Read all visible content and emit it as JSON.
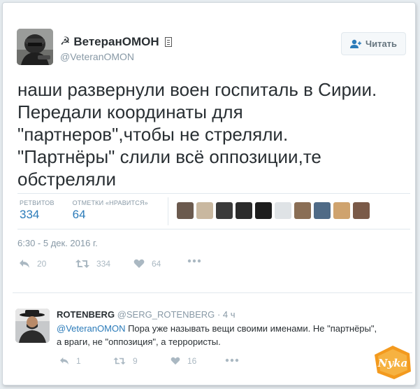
{
  "tweet": {
    "display_name": "ВетеранОМОН",
    "handle": "@VeteranOMON",
    "follow_label": "Читать",
    "text_lines": [
      "наши развернули воен госпиталь в Сирии.",
      "Передали координаты для",
      "\"партнеров\",чтобы не стреляли.",
      "\"Партнёры\" слили всё оппозиции,те",
      "обстреляли"
    ],
    "retweets_label": "РЕТВИТОВ",
    "retweets_value": "334",
    "likes_label": "ОТМЕТКИ «НРАВИТСЯ»",
    "likes_value": "64",
    "timestamp": "6:30 - 5 дек. 2016 г.",
    "reply_count": "20",
    "retweet_count": "334",
    "like_count": "64",
    "liker_colors": [
      "#6b5a4e",
      "#c9b8a0",
      "#3a3a3a",
      "#2b2b2b",
      "#1d1d1d",
      "#dfe3e6",
      "#8a6e55",
      "#4f6a86",
      "#cfa36e",
      "#7a5a48"
    ]
  },
  "reply": {
    "display_name": "ROTENBERG",
    "handle": "@SERG_ROTENBERG",
    "dot": "·",
    "time": "4 ч",
    "mention": "@VeteranOMON",
    "text_line1": " Пора уже называть вещи своими именами. Не \"партнёры\",",
    "text_line2": "а враги, не \"оппозиция\", а террористы.",
    "reply_count": "1",
    "retweet_count": "9",
    "like_count": "16"
  },
  "watermark_text": "Nyka",
  "colors": {
    "link": "#2b7bb9",
    "muted": "#8899a6",
    "action": "#aab8c2"
  }
}
